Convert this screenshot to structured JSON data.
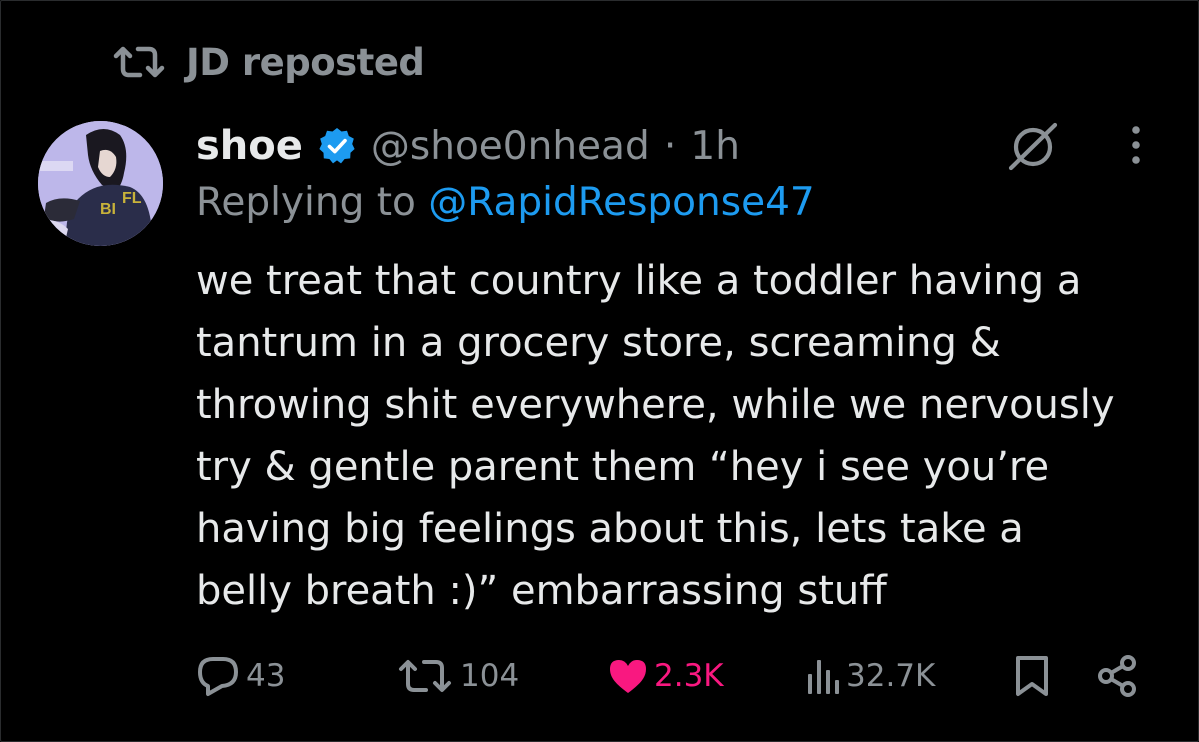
{
  "repost": {
    "label": "JD reposted",
    "icon": "repost-icon"
  },
  "post": {
    "author_name": "shoe",
    "verified": true,
    "handle": "@shoe0nhead",
    "separator": "·",
    "time": "1h",
    "replying_prefix": "Replying to ",
    "replying_to": "@RapidResponse47",
    "text": "we treat that country like a toddler having a\ntantrum in a grocery store, screaming &\nthrowing shit everywhere, while we nervously\ntry & gentle parent them “hey i see you’re\nhaving big feelings about this, lets take a\nbelly breath :)” embarrassing stuff"
  },
  "actions": {
    "replies": "43",
    "reposts": "104",
    "likes": "2.3K",
    "views": "32.7K"
  },
  "colors": {
    "background": "#000000",
    "text": "#e7e9ea",
    "muted": "#8b9196",
    "link": "#1d9bf0",
    "like": "#f91880",
    "verified": "#1d9bf0"
  }
}
